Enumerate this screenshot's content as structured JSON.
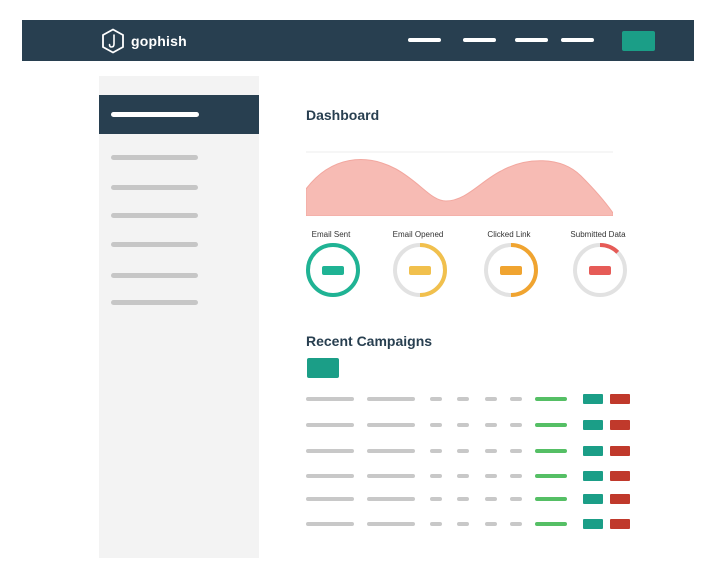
{
  "brand": {
    "name": "gophish",
    "icon": "gophish-hexagon-hook-icon"
  },
  "header": {
    "nav_link_count": 4,
    "action_button_color": "#1b9e87"
  },
  "sidebar": {
    "active_index": 0,
    "item_count": 7
  },
  "main": {
    "title": "Dashboard",
    "stats": [
      {
        "label": "Email Sent",
        "color": "#1fb394",
        "level": 1.0
      },
      {
        "label": "Email Opened",
        "color": "#f1c04d",
        "level": 0.5
      },
      {
        "label": "Clicked Link",
        "color": "#f0a430",
        "level": 0.5
      },
      {
        "label": "Submitted Data",
        "color": "#e65b57",
        "level": 0.12
      }
    ],
    "campaigns_title": "Recent Campaigns",
    "campaign_row_count": 6
  },
  "colors": {
    "navbar": "#283f50",
    "accent": "#1b9e87",
    "danger": "#c0392b",
    "status_ok": "#55bf65",
    "timeline_fill": "#f7bbb4"
  }
}
